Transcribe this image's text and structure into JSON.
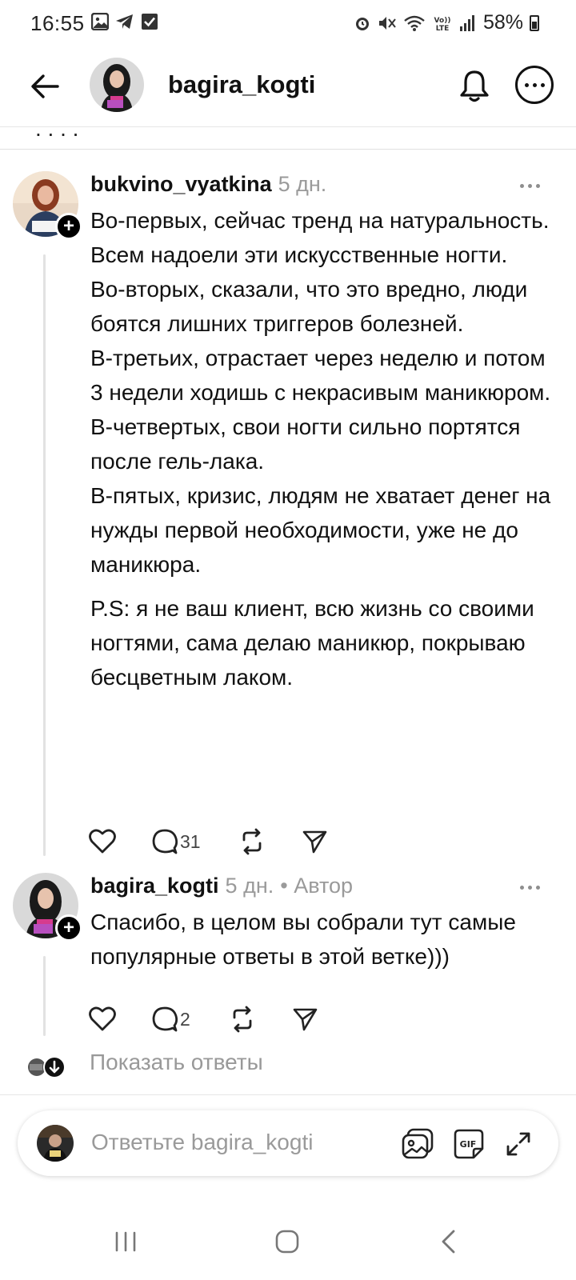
{
  "status_bar": {
    "time": "16:55",
    "battery": "58%",
    "left_icons": [
      "gallery-icon",
      "telegram-icon",
      "checkbox-icon"
    ],
    "right_icons": [
      "alarm-icon",
      "mute-icon",
      "wifi-icon",
      "volte-icon",
      "signal-icon",
      "battery-icon"
    ]
  },
  "header": {
    "title": "bagira_kogti",
    "icons": [
      "back-arrow-icon",
      "bell-icon",
      "more-icon"
    ]
  },
  "comments": [
    {
      "username": "bukvino_vyatkina",
      "time": "5 дн.",
      "author_badge": "",
      "paragraphs": [
        "Во-первых, сейчас тренд на натуральность. Всем надоели эти искусственные ногти.",
        "Во-вторых, сказали, что это вредно, люди боятся лишних триггеров болезней.",
        "В-третьих, отрастает через неделю и потом 3 недели ходишь с некрасивым маникюром.",
        "В-четвертых, свои ногти сильно портятся после гель-лака.",
        "В-пятых, кризис, людям не хватает денег на нужды первой необходимости, уже не до маникюра."
      ],
      "postscript": "P.S: я не ваш клиент, всю жизнь со своими ногтями, сама делаю маникюр, покрываю бесцветным лаком.",
      "reply_count": "31"
    },
    {
      "username": "bagira_kogti",
      "time": "5 дн.",
      "author_badge": "• Автор",
      "paragraphs": [
        "Спасибо, в целом вы собрали тут самые популярные ответы в этой ветке)))"
      ],
      "postscript": "",
      "reply_count": "2"
    }
  ],
  "show_replies_label": "Показать ответы",
  "reply_bar": {
    "placeholder": "Ответьте bagira_kogti",
    "icons": [
      "image-icon",
      "gif-icon",
      "expand-icon"
    ]
  },
  "nav_bar": {
    "icons": [
      "recents-icon",
      "home-icon",
      "back-icon"
    ]
  },
  "colors": {
    "text": "#111111",
    "muted": "#9a9a9a",
    "divider": "#e6e6e6",
    "thread_line": "#e2e2e2"
  }
}
